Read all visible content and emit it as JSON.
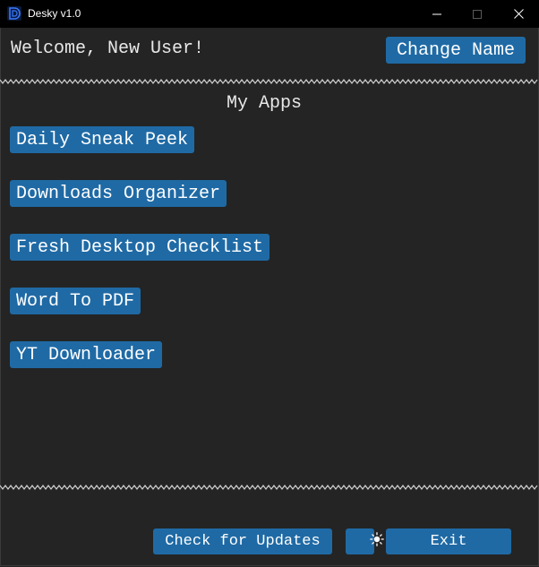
{
  "window": {
    "title": "Desky v1.0",
    "icon": "desky-logo-icon",
    "controls": [
      "minimize-icon",
      "maximize-icon",
      "close-icon"
    ]
  },
  "header": {
    "welcome_text": "Welcome, New User!",
    "change_name_label": "Change Name"
  },
  "apps_section": {
    "title": "My Apps",
    "apps": [
      {
        "label": "Daily Sneak Peek"
      },
      {
        "label": "Downloads Organizer"
      },
      {
        "label": "Fresh Desktop Checklist"
      },
      {
        "label": "Word To PDF"
      },
      {
        "label": "YT Downloader"
      }
    ]
  },
  "footer": {
    "check_updates_label": "Check for Updates",
    "theme_toggle_icon": "sun-icon",
    "exit_label": "Exit"
  },
  "colors": {
    "background": "#242424",
    "titlebar": "#000000",
    "button": "#1f6aa5",
    "text": "#e6e6e6"
  }
}
